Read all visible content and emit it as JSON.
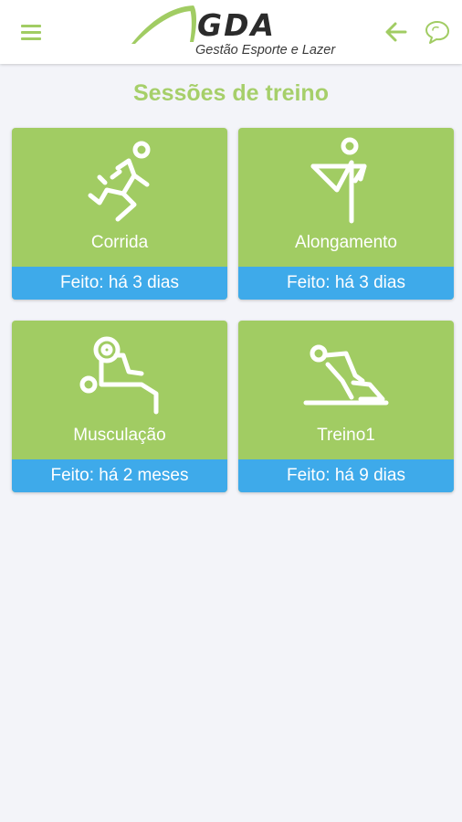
{
  "header": {
    "brand_name": "GDA",
    "brand_tagline": "Gestão Esporte e Lazer",
    "icons": {
      "menu": "hamburger-menu-icon",
      "back": "arrow-left-icon",
      "chat": "chat-bubble-icon"
    }
  },
  "page": {
    "title": "Sessões de treino"
  },
  "sessions": [
    {
      "label": "Corrida",
      "status": "Feito: há 3 dias",
      "icon": "running-icon"
    },
    {
      "label": "Alongamento",
      "status": "Feito: há 3 dias",
      "icon": "stretching-icon"
    },
    {
      "label": "Musculação",
      "status": "Feito: há 2 meses",
      "icon": "weight-training-icon"
    },
    {
      "label": "Treino1",
      "status": "Feito: há 9 dias",
      "icon": "floor-exercise-icon"
    }
  ],
  "colors": {
    "accent_green": "#a1cc63",
    "status_blue": "#3eaaea",
    "title_green": "#a6cf6a",
    "background": "#f3f4f9"
  }
}
